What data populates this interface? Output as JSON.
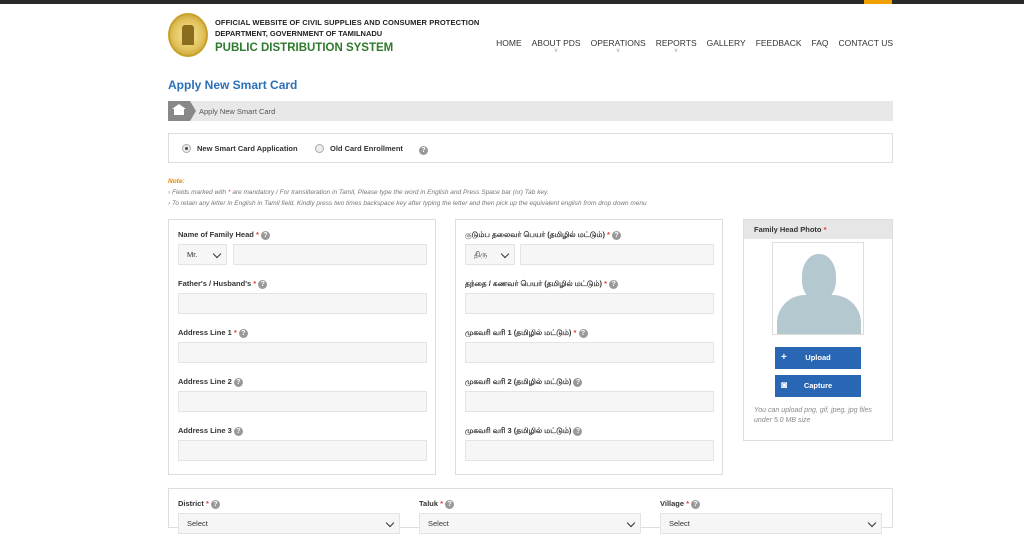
{
  "header": {
    "org_line1": "OFFICIAL WEBSITE OF CIVIL SUPPLIES AND CONSUMER PROTECTION",
    "org_line2": "DEPARTMENT, GOVERNMENT OF TAMILNADU",
    "org_line3": "PUBLIC DISTRIBUTION SYSTEM"
  },
  "nav": {
    "items": [
      {
        "label": "HOME",
        "dropdown": false
      },
      {
        "label": "ABOUT PDS",
        "dropdown": true
      },
      {
        "label": "OPERATIONS",
        "dropdown": true
      },
      {
        "label": "REPORTS",
        "dropdown": true
      },
      {
        "label": "GALLERY",
        "dropdown": false
      },
      {
        "label": "FEEDBACK",
        "dropdown": false
      },
      {
        "label": "FAQ",
        "dropdown": false
      },
      {
        "label": "CONTACT US",
        "dropdown": false
      }
    ],
    "dropdown_glyph": "v"
  },
  "page": {
    "title": "Apply New Smart Card",
    "breadcrumb": "Apply New Smart Card"
  },
  "application_type": {
    "options": [
      {
        "label": "New Smart Card Application",
        "selected": true
      },
      {
        "label": "Old Card Enrollment",
        "selected": false
      }
    ]
  },
  "help_glyph": "?",
  "notes": {
    "title": "Note:",
    "line1_prefix": "› Fields marked with",
    "mark": "*",
    "line1_suffix": "are mandatory  / For transliteration in Tamil, Please type the word in English and Press Space bar (or) Tab key.",
    "line2": "› To retain any letter in English in Tamil field, Kindly press two times backspace key after typing the letter and then pick up the equivalent english from drop down menu"
  },
  "english_form": {
    "family_head_label": "Name of Family Head",
    "title_select": "Mr.",
    "father_label": "Father's / Husband's",
    "address1_label": "Address Line 1",
    "address2_label": "Address Line 2",
    "address3_label": "Address Line 3",
    "required_mark": "*"
  },
  "tamil_form": {
    "family_head_label": "குடும்ப தலைவர் பெயர் (தமிழில் மட்டும்)",
    "title_select": "திரு",
    "father_label": "தந்தை / கணவர் பெயர் (தமிழில் மட்டும்)",
    "address1_label": "முகவரி வரி 1 (தமிழில் மட்டும்)",
    "address2_label": "முகவரி வரி 2 (தமிழில் மட்டும்)",
    "address3_label": "முகவரி வரி 3 (தமிழில் மட்டும்)"
  },
  "photo": {
    "title": "Family Head Photo",
    "upload_label": "Upload",
    "upload_icon": "+",
    "capture_label": "Capture",
    "capture_icon": "◙",
    "note": "You can upload png, gif, jpeg, jpg files under 5.0 MB size"
  },
  "location": {
    "district_label": "District",
    "taluk_label": "Taluk",
    "village_label": "Village",
    "select_placeholder": "Select"
  }
}
